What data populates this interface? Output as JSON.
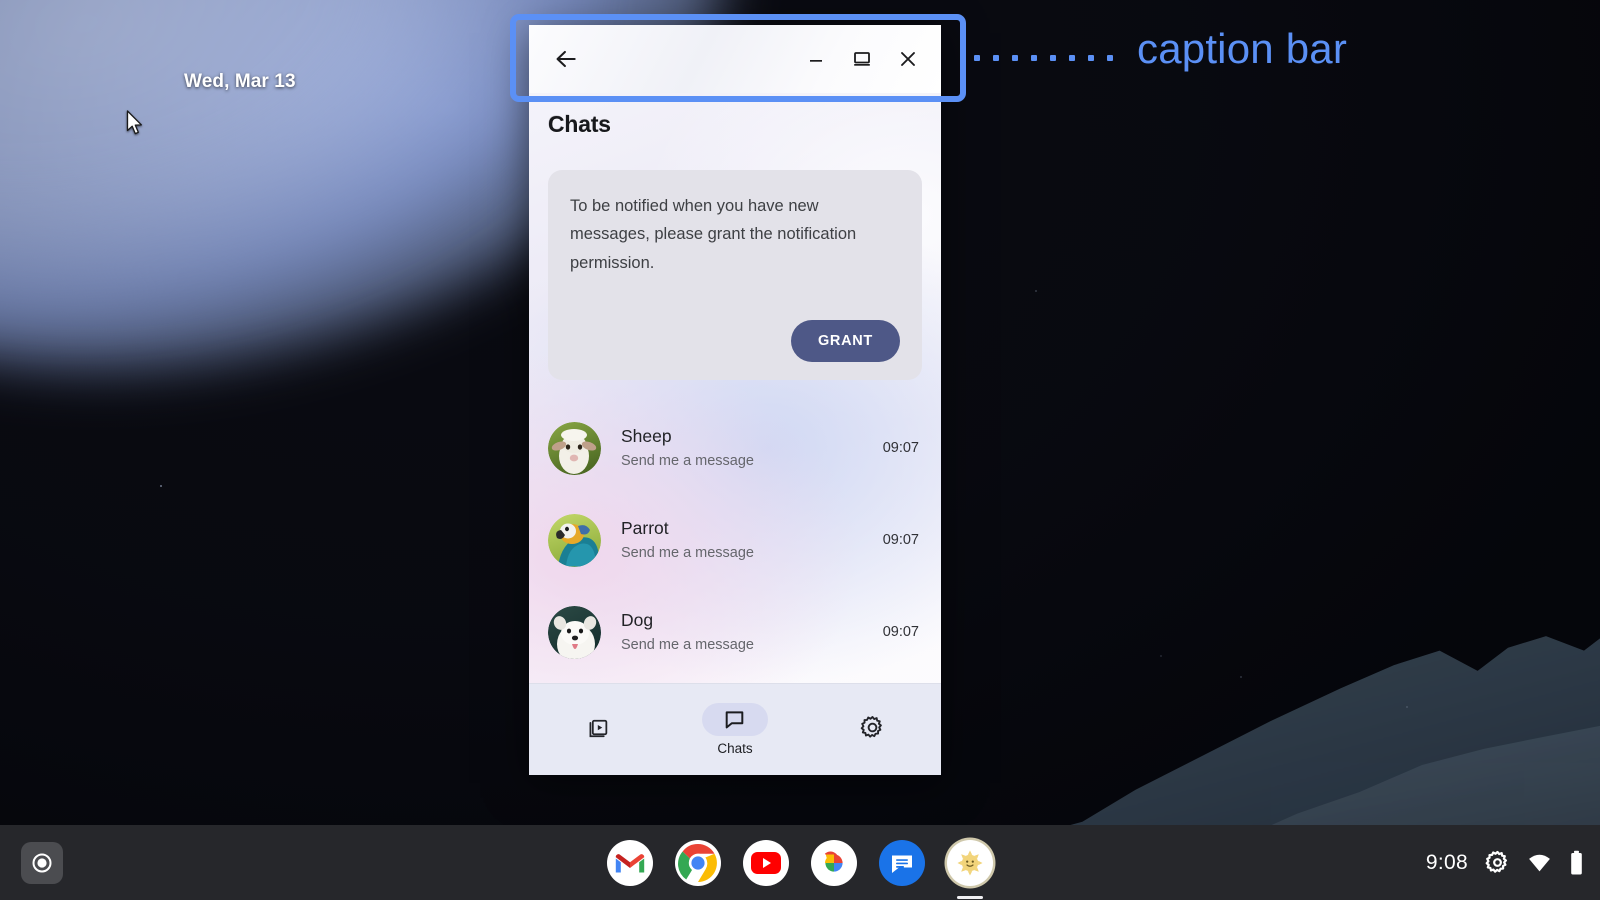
{
  "desktop": {
    "date": "Wed, Mar 13",
    "cursor_icon": "arrow-cursor"
  },
  "annotation": {
    "label": "caption bar",
    "color": "#5b90f5",
    "target": "caption-bar"
  },
  "window": {
    "caption": {
      "back_icon": "back-arrow-icon",
      "minimize_icon": "minimize-icon",
      "maximize_icon": "maximize-restore-icon",
      "close_icon": "close-icon"
    },
    "app": {
      "title": "Chats",
      "permission_card": {
        "message": "To be notified when you have new messages, please grant the notification permission.",
        "button_label": "GRANT",
        "button_color": "#4e5887",
        "card_color": "#e3e2e9"
      },
      "chats": [
        {
          "name": "Sheep",
          "preview": "Send me a message",
          "time": "09:07",
          "avatar_icon": "sheep-avatar"
        },
        {
          "name": "Parrot",
          "preview": "Send me a message",
          "time": "09:07",
          "avatar_icon": "parrot-avatar"
        },
        {
          "name": "Dog",
          "preview": "Send me a message",
          "time": "09:07",
          "avatar_icon": "dog-avatar"
        }
      ],
      "bottom_nav": [
        {
          "label": "",
          "icon": "media-library-icon",
          "active": false
        },
        {
          "label": "Chats",
          "icon": "chat-bubble-icon",
          "active": true
        },
        {
          "label": "",
          "icon": "gear-icon",
          "active": false
        }
      ]
    }
  },
  "shelf": {
    "launcher_icon": "launcher-icon",
    "apps": [
      {
        "name": "Gmail",
        "icon": "gmail-icon",
        "active": false
      },
      {
        "name": "Chrome",
        "icon": "chrome-icon",
        "active": false
      },
      {
        "name": "YouTube",
        "icon": "youtube-icon",
        "active": false
      },
      {
        "name": "Google Photos",
        "icon": "photos-icon",
        "active": false
      },
      {
        "name": "Google Messages",
        "icon": "messages-icon",
        "active": false
      },
      {
        "name": "Sun App",
        "icon": "sun-app-icon",
        "active": true
      }
    ],
    "status": {
      "time": "9:08",
      "settings_icon": "gear-icon",
      "wifi_icon": "wifi-icon",
      "battery_icon": "battery-icon"
    }
  }
}
